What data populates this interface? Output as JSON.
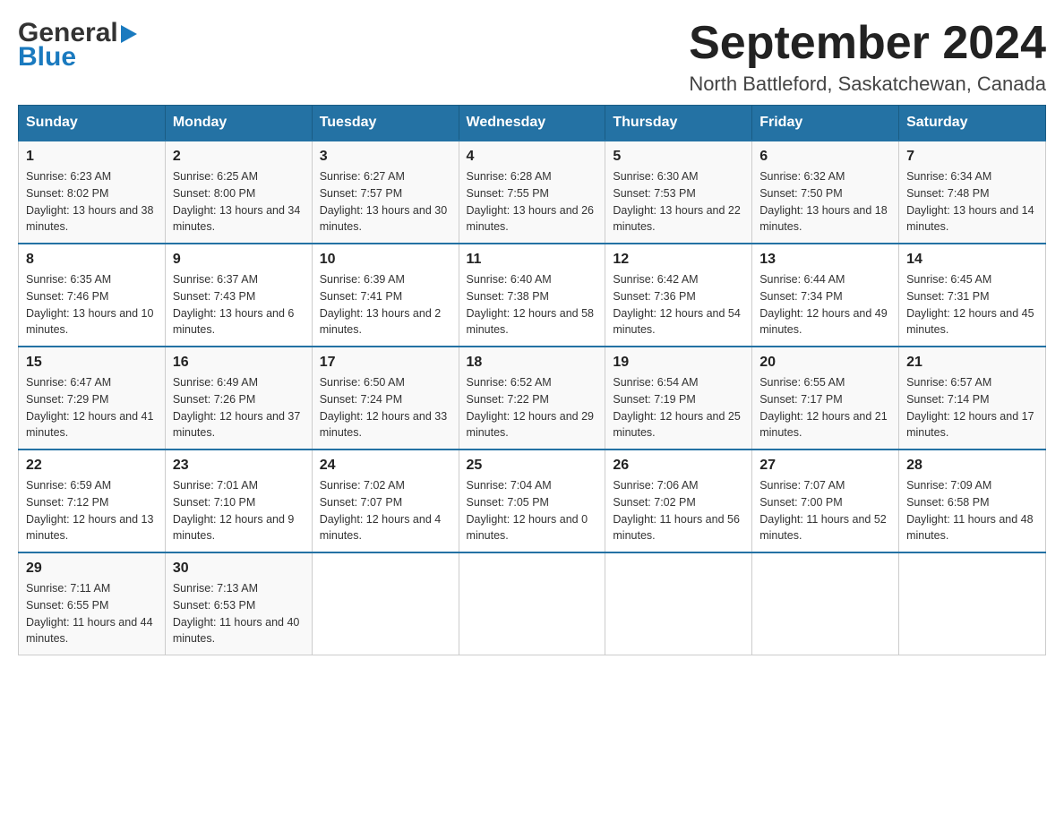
{
  "header": {
    "logo_general": "General",
    "logo_blue": "Blue",
    "month": "September 2024",
    "location": "North Battleford, Saskatchewan, Canada"
  },
  "days_of_week": [
    "Sunday",
    "Monday",
    "Tuesday",
    "Wednesday",
    "Thursday",
    "Friday",
    "Saturday"
  ],
  "weeks": [
    [
      {
        "day": "1",
        "sunrise": "6:23 AM",
        "sunset": "8:02 PM",
        "daylight": "13 hours and 38 minutes."
      },
      {
        "day": "2",
        "sunrise": "6:25 AM",
        "sunset": "8:00 PM",
        "daylight": "13 hours and 34 minutes."
      },
      {
        "day": "3",
        "sunrise": "6:27 AM",
        "sunset": "7:57 PM",
        "daylight": "13 hours and 30 minutes."
      },
      {
        "day": "4",
        "sunrise": "6:28 AM",
        "sunset": "7:55 PM",
        "daylight": "13 hours and 26 minutes."
      },
      {
        "day": "5",
        "sunrise": "6:30 AM",
        "sunset": "7:53 PM",
        "daylight": "13 hours and 22 minutes."
      },
      {
        "day": "6",
        "sunrise": "6:32 AM",
        "sunset": "7:50 PM",
        "daylight": "13 hours and 18 minutes."
      },
      {
        "day": "7",
        "sunrise": "6:34 AM",
        "sunset": "7:48 PM",
        "daylight": "13 hours and 14 minutes."
      }
    ],
    [
      {
        "day": "8",
        "sunrise": "6:35 AM",
        "sunset": "7:46 PM",
        "daylight": "13 hours and 10 minutes."
      },
      {
        "day": "9",
        "sunrise": "6:37 AM",
        "sunset": "7:43 PM",
        "daylight": "13 hours and 6 minutes."
      },
      {
        "day": "10",
        "sunrise": "6:39 AM",
        "sunset": "7:41 PM",
        "daylight": "13 hours and 2 minutes."
      },
      {
        "day": "11",
        "sunrise": "6:40 AM",
        "sunset": "7:38 PM",
        "daylight": "12 hours and 58 minutes."
      },
      {
        "day": "12",
        "sunrise": "6:42 AM",
        "sunset": "7:36 PM",
        "daylight": "12 hours and 54 minutes."
      },
      {
        "day": "13",
        "sunrise": "6:44 AM",
        "sunset": "7:34 PM",
        "daylight": "12 hours and 49 minutes."
      },
      {
        "day": "14",
        "sunrise": "6:45 AM",
        "sunset": "7:31 PM",
        "daylight": "12 hours and 45 minutes."
      }
    ],
    [
      {
        "day": "15",
        "sunrise": "6:47 AM",
        "sunset": "7:29 PM",
        "daylight": "12 hours and 41 minutes."
      },
      {
        "day": "16",
        "sunrise": "6:49 AM",
        "sunset": "7:26 PM",
        "daylight": "12 hours and 37 minutes."
      },
      {
        "day": "17",
        "sunrise": "6:50 AM",
        "sunset": "7:24 PM",
        "daylight": "12 hours and 33 minutes."
      },
      {
        "day": "18",
        "sunrise": "6:52 AM",
        "sunset": "7:22 PM",
        "daylight": "12 hours and 29 minutes."
      },
      {
        "day": "19",
        "sunrise": "6:54 AM",
        "sunset": "7:19 PM",
        "daylight": "12 hours and 25 minutes."
      },
      {
        "day": "20",
        "sunrise": "6:55 AM",
        "sunset": "7:17 PM",
        "daylight": "12 hours and 21 minutes."
      },
      {
        "day": "21",
        "sunrise": "6:57 AM",
        "sunset": "7:14 PM",
        "daylight": "12 hours and 17 minutes."
      }
    ],
    [
      {
        "day": "22",
        "sunrise": "6:59 AM",
        "sunset": "7:12 PM",
        "daylight": "12 hours and 13 minutes."
      },
      {
        "day": "23",
        "sunrise": "7:01 AM",
        "sunset": "7:10 PM",
        "daylight": "12 hours and 9 minutes."
      },
      {
        "day": "24",
        "sunrise": "7:02 AM",
        "sunset": "7:07 PM",
        "daylight": "12 hours and 4 minutes."
      },
      {
        "day": "25",
        "sunrise": "7:04 AM",
        "sunset": "7:05 PM",
        "daylight": "12 hours and 0 minutes."
      },
      {
        "day": "26",
        "sunrise": "7:06 AM",
        "sunset": "7:02 PM",
        "daylight": "11 hours and 56 minutes."
      },
      {
        "day": "27",
        "sunrise": "7:07 AM",
        "sunset": "7:00 PM",
        "daylight": "11 hours and 52 minutes."
      },
      {
        "day": "28",
        "sunrise": "7:09 AM",
        "sunset": "6:58 PM",
        "daylight": "11 hours and 48 minutes."
      }
    ],
    [
      {
        "day": "29",
        "sunrise": "7:11 AM",
        "sunset": "6:55 PM",
        "daylight": "11 hours and 44 minutes."
      },
      {
        "day": "30",
        "sunrise": "7:13 AM",
        "sunset": "6:53 PM",
        "daylight": "11 hours and 40 minutes."
      },
      null,
      null,
      null,
      null,
      null
    ]
  ]
}
